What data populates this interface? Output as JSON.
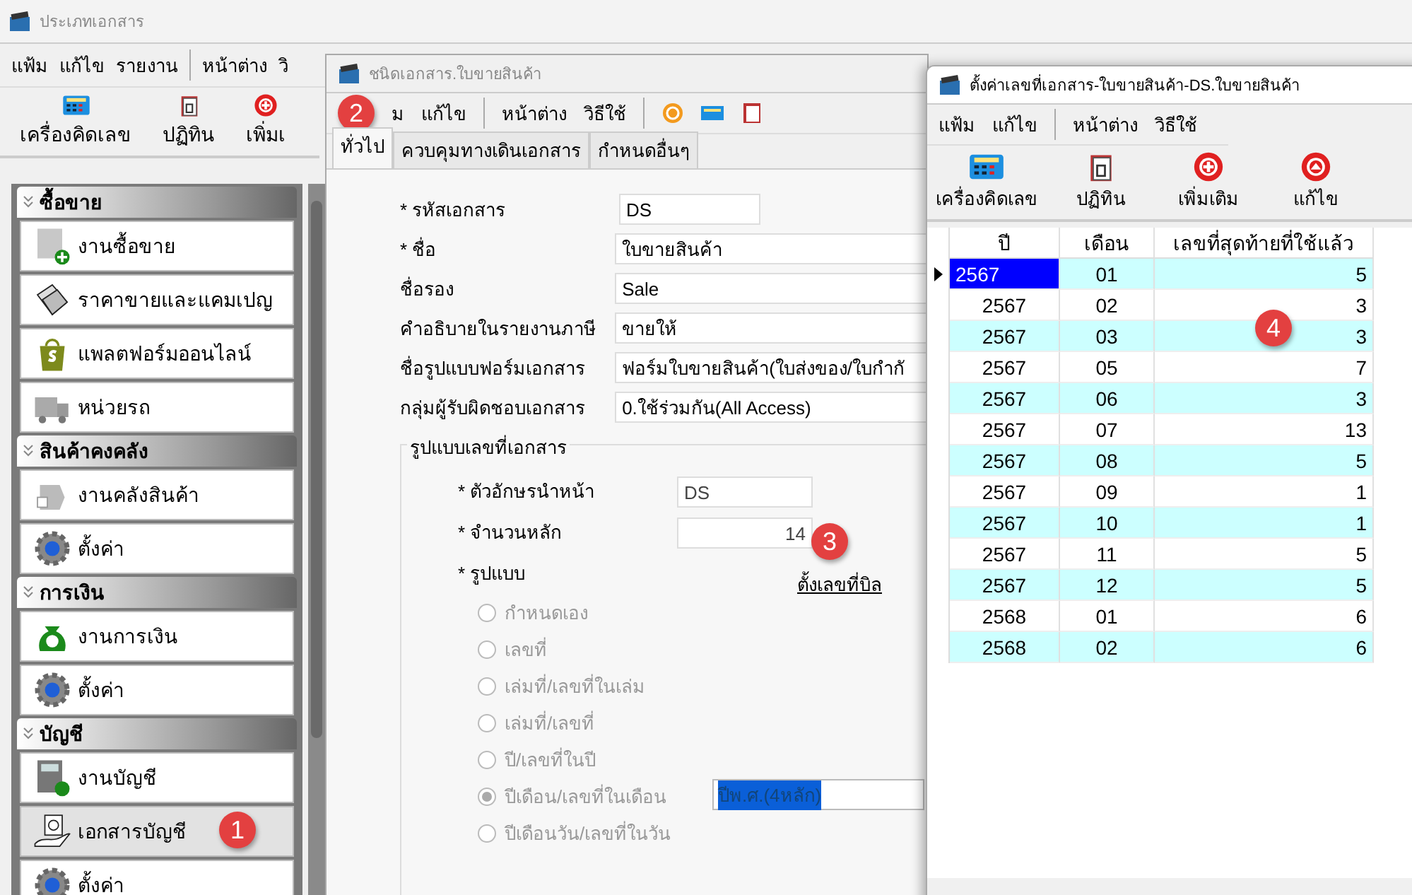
{
  "main_window": {
    "title": "ประเภทเอกสาร",
    "menu": [
      "แฟ้ม",
      "แก้ไข",
      "รายงาน",
      "หน้าต่าง",
      "วิ"
    ],
    "toolbar": [
      {
        "label": "เครื่องคิดเลข",
        "kind": "calculator"
      },
      {
        "label": "ปฏิทิน",
        "kind": "calendar"
      },
      {
        "label": "เพิ่มเ",
        "kind": "add"
      }
    ]
  },
  "sidebar": {
    "sections": [
      {
        "title": "ซื้อขาย",
        "items": [
          {
            "label": "งานซื้อขาย",
            "kind": "product",
            "selected": false
          },
          {
            "label": "ราคาขายและแคมเปญ",
            "kind": "tag",
            "selected": false
          },
          {
            "label": "แพลตฟอร์มออนไลน์",
            "kind": "bag",
            "selected": false
          },
          {
            "label": "หน่วยรถ",
            "kind": "truck",
            "selected": false
          }
        ]
      },
      {
        "title": "สินค้าคงคลัง",
        "items": [
          {
            "label": "งานคลังสินค้า",
            "kind": "stock",
            "selected": false
          },
          {
            "label": "ตั้งค่า",
            "kind": "gear",
            "selected": false
          }
        ]
      },
      {
        "title": "การเงิน",
        "items": [
          {
            "label": "งานการเงิน",
            "kind": "money",
            "selected": false
          },
          {
            "label": "ตั้งค่า",
            "kind": "gear",
            "selected": false
          }
        ]
      },
      {
        "title": "บัญชี",
        "items": [
          {
            "label": "งานบัญชี",
            "kind": "ledger",
            "selected": false
          },
          {
            "label": "เอกสารบัญชี",
            "kind": "document",
            "selected": true,
            "badge": "1"
          },
          {
            "label": "ตั้งค่า",
            "kind": "gear",
            "selected": false
          }
        ]
      }
    ]
  },
  "doc_type_window": {
    "title": "ชนิดเอกสาร.ใบขายสินค้า",
    "badge": "2",
    "menu": [
      "ม",
      "แก้ไข",
      "หน้าต่าง",
      "วิธีใช้"
    ],
    "toolbar": [
      {
        "kind": "refresh"
      },
      {
        "kind": "calculator"
      },
      {
        "kind": "calendar"
      }
    ],
    "tabs": [
      {
        "label": "ทั่วไป",
        "selected": true
      },
      {
        "label": "ควบคุมทางเดินเอกสาร",
        "selected": false
      },
      {
        "label": "กำหนดอื่นๆ",
        "selected": false
      }
    ],
    "fields": [
      {
        "label": "* รหัสเอกสาร",
        "value": "DS",
        "kind": "short"
      },
      {
        "label": "* ชื่อ",
        "value": "ใบขายสินค้า",
        "kind": "wide"
      },
      {
        "label": "ชื่อรอง",
        "value": "Sale",
        "kind": "wide"
      },
      {
        "label": "คำอธิบายในรายงานภาษี",
        "value": "ขายให้",
        "kind": "wide"
      },
      {
        "label": "ชื่อรูปแบบฟอร์มเอกสาร",
        "value": "ฟอร์มใบขายสินค้า(ใบส่งของ/ใบกำกั",
        "kind": "wide"
      },
      {
        "label": "กลุ่มผู้รับผิดชอบเอกสาร",
        "value": "0.ใช้ร่วมกัน(All Access)",
        "kind": "wide"
      }
    ],
    "numbering": {
      "title": "รูปแบบเลขที่เอกสาร",
      "prefix": {
        "label": "* ตัวอักษรนำหน้า",
        "value": "DS"
      },
      "digits": {
        "label": "* จำนวนหลัก",
        "value": "14"
      },
      "format_label": "* รูปแบบ",
      "formats": [
        {
          "label": "กำหนดเอง",
          "selected": false,
          "disabled": true
        },
        {
          "label": "เลขที่",
          "selected": false,
          "disabled": true
        },
        {
          "label": "เล่มที่/เลขที่ในเล่ม",
          "selected": false,
          "disabled": true
        },
        {
          "label": "เล่มที่/เลขที่",
          "selected": false,
          "disabled": true
        },
        {
          "label": "ปี/เลขที่ในปี",
          "selected": false,
          "disabled": true
        },
        {
          "label": "ปีเดือน/เลขที่ในเดือน",
          "selected": true,
          "disabled": true
        },
        {
          "label": "ปีเดือนวัน/เลขที่ในวัน",
          "selected": false,
          "disabled": true
        }
      ],
      "year_format": "ปีพ.ศ.(4หลัก)",
      "link": "ตั้งเลขที่บิล",
      "badge": "3"
    }
  },
  "numbers_window": {
    "title": "ตั้งค่าเลขที่เอกสาร-ใบขายสินค้า-DS.ใบขายสินค้า",
    "menu": [
      "แฟ้ม",
      "แก้ไข",
      "หน้าต่าง",
      "วิธีใช้"
    ],
    "toolbar": [
      {
        "label": "เครื่องคิดเลข",
        "kind": "calculator"
      },
      {
        "label": "ปฏิทิน",
        "kind": "calendar"
      },
      {
        "label": "เพิ่มเติม",
        "kind": "add"
      },
      {
        "label": "แก้ไข",
        "kind": "edit"
      }
    ],
    "table": {
      "columns": [
        "ปี",
        "เดือน",
        "เลขที่สุดท้ายที่ใช้แล้ว"
      ],
      "badge": "4",
      "rows": [
        {
          "year": "2567",
          "month": "01",
          "last": "5",
          "selected": true
        },
        {
          "year": "2567",
          "month": "02",
          "last": "3",
          "selected": false
        },
        {
          "year": "2567",
          "month": "03",
          "last": "3",
          "selected": false
        },
        {
          "year": "2567",
          "month": "05",
          "last": "7",
          "selected": false
        },
        {
          "year": "2567",
          "month": "06",
          "last": "3",
          "selected": false
        },
        {
          "year": "2567",
          "month": "07",
          "last": "13",
          "selected": false
        },
        {
          "year": "2567",
          "month": "08",
          "last": "5",
          "selected": false
        },
        {
          "year": "2567",
          "month": "09",
          "last": "1",
          "selected": false
        },
        {
          "year": "2567",
          "month": "10",
          "last": "1",
          "selected": false
        },
        {
          "year": "2567",
          "month": "11",
          "last": "5",
          "selected": false
        },
        {
          "year": "2567",
          "month": "12",
          "last": "5",
          "selected": false
        },
        {
          "year": "2568",
          "month": "01",
          "last": "6",
          "selected": false
        },
        {
          "year": "2568",
          "month": "02",
          "last": "6",
          "selected": false
        }
      ]
    }
  }
}
